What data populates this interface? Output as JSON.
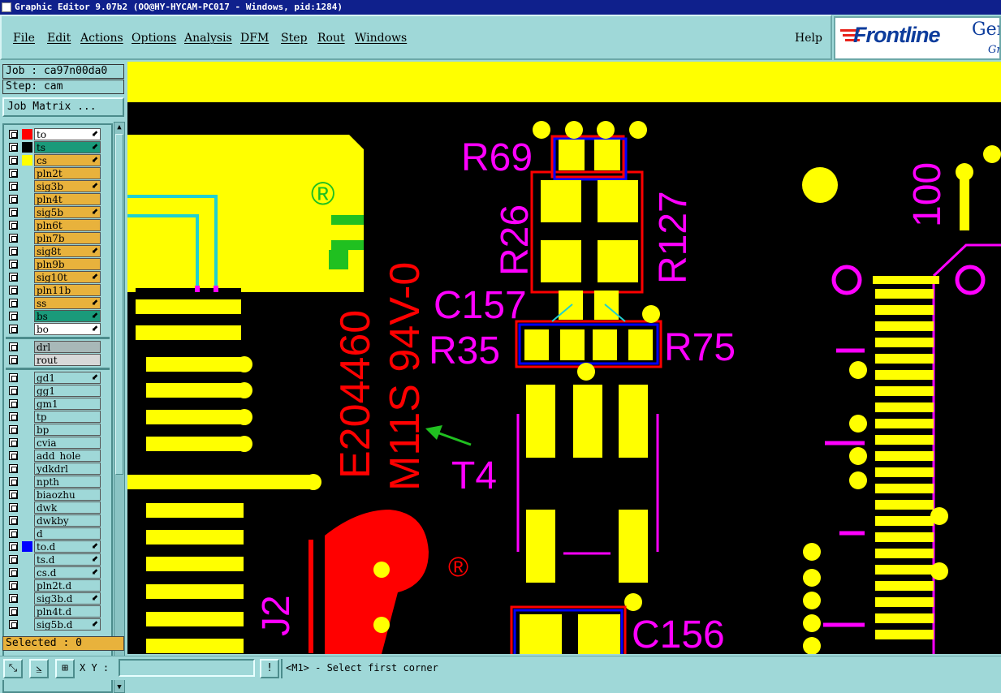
{
  "window": {
    "title": "Graphic Editor 9.07b2 (OO@HY-HYCAM-PC017 - Windows, pid:1284)"
  },
  "menu": {
    "items": [
      "File",
      "Edit",
      "Actions",
      "Options",
      "Analysis",
      "DFM",
      "Step",
      "Rout",
      "Windows"
    ],
    "help": "Help"
  },
  "brand": {
    "name": "Frontline",
    "suffix": "Gen",
    "sub": "Gr"
  },
  "job": {
    "label": "Job : ca97n00da0",
    "step": "Step: cam",
    "matrix_button": "Job Matrix ..."
  },
  "layers_board": [
    {
      "name": "to",
      "bg": "#ffffff",
      "swatch": "#ff0000",
      "flag": "⬋"
    },
    {
      "name": "ts",
      "bg": "#1a9a7a",
      "swatch": "#000000",
      "flag": "⬋"
    },
    {
      "name": "cs",
      "bg": "#e8b23c",
      "swatch": "#ffff00",
      "flag": "⬋"
    },
    {
      "name": "pln2t",
      "bg": "#e8b23c",
      "swatch": "",
      "flag": ""
    },
    {
      "name": "sig3b",
      "bg": "#e8b23c",
      "swatch": "",
      "flag": "⬋"
    },
    {
      "name": "pln4t",
      "bg": "#e8b23c",
      "swatch": "",
      "flag": ""
    },
    {
      "name": "sig5b",
      "bg": "#e8b23c",
      "swatch": "",
      "flag": "⬋"
    },
    {
      "name": "pln6t",
      "bg": "#e8b23c",
      "swatch": "",
      "flag": ""
    },
    {
      "name": "pln7b",
      "bg": "#e8b23c",
      "swatch": "",
      "flag": ""
    },
    {
      "name": "sig8t",
      "bg": "#e8b23c",
      "swatch": "",
      "flag": "⬋"
    },
    {
      "name": "pln9b",
      "bg": "#e8b23c",
      "swatch": "",
      "flag": ""
    },
    {
      "name": "sig10t",
      "bg": "#e8b23c",
      "swatch": "",
      "flag": "⬋"
    },
    {
      "name": "pln11b",
      "bg": "#e8b23c",
      "swatch": "",
      "flag": ""
    },
    {
      "name": "ss",
      "bg": "#e8b23c",
      "swatch": "",
      "flag": "⬋"
    },
    {
      "name": "bs",
      "bg": "#1a9a7a",
      "swatch": "",
      "flag": "⬋"
    },
    {
      "name": "bo",
      "bg": "#ffffff",
      "swatch": "",
      "flag": "⬋"
    }
  ],
  "layers_drill": [
    {
      "name": "drl",
      "bg": "#a8b8b8",
      "swatch": "",
      "flag": ""
    },
    {
      "name": "rout",
      "bg": "#d8d8d8",
      "swatch": "",
      "flag": ""
    }
  ],
  "layers_misc": [
    {
      "name": "gd1",
      "bg": "#9fd8d8",
      "swatch": "",
      "flag": "⬋"
    },
    {
      "name": "gg1",
      "bg": "#9fd8d8",
      "swatch": "",
      "flag": ""
    },
    {
      "name": "gm1",
      "bg": "#9fd8d8",
      "swatch": "",
      "flag": ""
    },
    {
      "name": "tp",
      "bg": "#9fd8d8",
      "swatch": "",
      "flag": ""
    },
    {
      "name": "bp",
      "bg": "#9fd8d8",
      "swatch": "",
      "flag": ""
    },
    {
      "name": "cvia",
      "bg": "#9fd8d8",
      "swatch": "",
      "flag": ""
    },
    {
      "name": "add_hole",
      "bg": "#9fd8d8",
      "swatch": "",
      "flag": ""
    },
    {
      "name": "ydkdrl",
      "bg": "#9fd8d8",
      "swatch": "",
      "flag": ""
    },
    {
      "name": "npth",
      "bg": "#9fd8d8",
      "swatch": "",
      "flag": ""
    },
    {
      "name": "biaozhu",
      "bg": "#9fd8d8",
      "swatch": "",
      "flag": ""
    },
    {
      "name": "dwk",
      "bg": "#9fd8d8",
      "swatch": "",
      "flag": ""
    },
    {
      "name": "dwkby",
      "bg": "#9fd8d8",
      "swatch": "",
      "flag": ""
    },
    {
      "name": "d",
      "bg": "#9fd8d8",
      "swatch": "",
      "flag": ""
    },
    {
      "name": "to.d",
      "bg": "#9fd8d8",
      "swatch": "#0000ff",
      "flag": "⬋"
    },
    {
      "name": "ts.d",
      "bg": "#9fd8d8",
      "swatch": "",
      "flag": "⬋"
    },
    {
      "name": "cs.d",
      "bg": "#9fd8d8",
      "swatch": "",
      "flag": "⬋"
    },
    {
      "name": "pln2t.d",
      "bg": "#9fd8d8",
      "swatch": "",
      "flag": ""
    },
    {
      "name": "sig3b.d",
      "bg": "#9fd8d8",
      "swatch": "",
      "flag": "⬋"
    },
    {
      "name": "pln4t.d",
      "bg": "#9fd8d8",
      "swatch": "",
      "flag": ""
    },
    {
      "name": "sig5b.d",
      "bg": "#9fd8d8",
      "swatch": "",
      "flag": "⬋"
    }
  ],
  "selected": "Selected : 0",
  "silk_labels": [
    "R69",
    "R26",
    "R127",
    "C157",
    "R35",
    "R75",
    "T4",
    "C156",
    "100",
    "J2"
  ],
  "marking_red": [
    "E204460",
    "M11S 94V-0",
    "®",
    "®"
  ],
  "marking_green": [
    "®"
  ],
  "status": {
    "xy_label": "X Y :",
    "xy_value": "",
    "prompt": "<M1> - Select first corner"
  },
  "colors": {
    "title_bg": "#0f208c",
    "ui_bg": "#9fd8d8",
    "canvas_bg": "#000000",
    "copper": "#ffff00",
    "silk": "#ff00ff",
    "mask": "#ff0000"
  }
}
